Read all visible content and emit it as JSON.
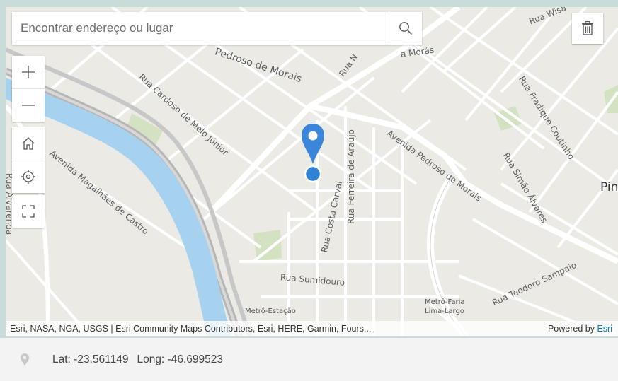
{
  "search": {
    "placeholder": "Encontrar endereço ou lugar"
  },
  "icons": {
    "search": "search-icon",
    "trash": "trash-icon",
    "zoom_in": "plus-icon",
    "zoom_out": "minus-icon",
    "home": "home-icon",
    "locate": "crosshair-icon",
    "fullscreen": "fullscreen-icon",
    "pin": "location-pin-icon"
  },
  "map": {
    "labels": [
      "Rua Wisa",
      "a Morás",
      "Pedroso de Morais",
      "Rua N",
      "Rua Cardoso de Melo Júnior",
      "Rua Ferreira de Araújo",
      "Rua Fradique Coutinho",
      "Avenida Pedroso de Morais",
      "Rua Simão Álvares",
      "Pin",
      "Avenida Magalhães de Castro",
      "Rua Alvarenga",
      "Rua Costa Carval",
      "Rua Sumidouro",
      "Rua Teodoro Sampaio",
      "Metrô-Estação",
      "Metrô-Faria",
      "Lima-Largo"
    ],
    "colors": {
      "river": "#a6d2ef",
      "land": "#ebeae4",
      "park": "#d3e3c2",
      "marker": "#2e83d4"
    }
  },
  "attribution": {
    "text": "Esri, NASA, NGA, USGS | Esri Community Maps Contributors, Esri, HERE, Garmin, Fours...",
    "powered_by": "Powered by",
    "esri": "Esri"
  },
  "coords": {
    "lat": "Lat: -23.561149",
    "long": "Long: -46.699523"
  }
}
